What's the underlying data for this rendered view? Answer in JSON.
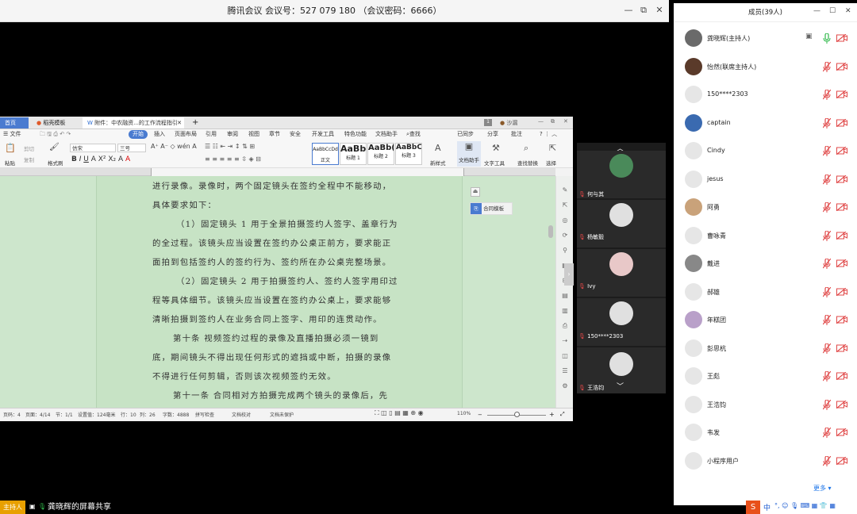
{
  "meeting": {
    "title": "腾讯会议 会议号：527 079 180 （会议密码：6666）",
    "ctrl_min": "—",
    "ctrl_restore": "⧉",
    "ctrl_close": "✕"
  },
  "wps": {
    "tabs": [
      "首页",
      "稻壳模板",
      "附件：中农融资...的工作流程指引"
    ],
    "tab_add": "+",
    "doc_user": "沙漏",
    "menus": [
      "☰ 文件",
      "开始",
      "插入",
      "页面布局",
      "引用",
      "审阅",
      "视图",
      "章节",
      "安全",
      "开发工具",
      "特色功能",
      "文档助手",
      "查找"
    ],
    "right_menus": [
      "已同步",
      "分享",
      "批注"
    ],
    "ribbon": {
      "paste": "粘贴",
      "cut": "剪切",
      "copy": "复制",
      "format_painter": "格式刷",
      "font": "仿宋",
      "size": "三号",
      "styles": [
        {
          "sample": "AaBbCcDd",
          "name": "正文"
        },
        {
          "sample": "AaBb",
          "name": "标题 1"
        },
        {
          "sample": "AaBb(",
          "name": "标题 2"
        },
        {
          "sample": "AaBbC(",
          "name": "标题 3"
        }
      ],
      "new_style": "新样式",
      "doc_helper": "文档助手",
      "text_tools": "文字工具",
      "find_replace": "查找替换",
      "select": "选择"
    },
    "doc_lines": [
      "进行录像。录像时，两个固定镜头在签约全程中不能移动，",
      "具体要求如下：",
      "（1）固定镜头 1 用于全景拍摄签约人签字、盖章行为",
      "的全过程。该镜头应当设置在签约办公桌正前方，要求能正",
      "面拍到包括签约人的签约行为、签约所在办公桌完整场景。",
      "（2）固定镜头 2 用于拍摄签约人、签约人签字用印过",
      "程等具体细节。该镜头应当设置在签约办公桌上，要求能够",
      "清晰拍摄到签约人在业务合同上签字、用印的连贯动作。",
      "第十条  视频签约过程的录像及直播拍摄必须一镜到",
      "底，期间镜头不得出现任何形式的遮挡或中断，拍摄的录像",
      "不得进行任何剪辑，否则该次视频签约无效。",
      "第十一条  合同相对方拍摄完成两个镜头的录像后，先"
    ],
    "float_panel": "合同模板",
    "status": {
      "page": "页码：4",
      "pages": "页面：4/14",
      "section": "节：1/1",
      "setting": "设置值：124毫米",
      "row": "行：10",
      "col": "列：26",
      "words": "字数：4888",
      "spell": "拼写检查",
      "proof": "文档校对",
      "protect": "文档未保护",
      "zoom": "110%"
    }
  },
  "video": {
    "up": "︿",
    "down": "﹀",
    "tiles": [
      {
        "name": "何与其"
      },
      {
        "name": "杨敏毅"
      },
      {
        "name": "Ivy"
      },
      {
        "name": "150****2303"
      },
      {
        "name": "王浩钧"
      }
    ]
  },
  "members": {
    "title": "成员(39人)",
    "ctrl_min": "—",
    "ctrl_max": "☐",
    "ctrl_close": "✕",
    "list": [
      {
        "name": "龚晓辉(主持人)",
        "avatar": "#6a6a6a",
        "mic": "on"
      },
      {
        "name": "怡然(联席主持人)",
        "avatar": "#5a3a2a",
        "mic": "off"
      },
      {
        "name": "150****2303",
        "avatar": "#e6e6e6",
        "mic": "off"
      },
      {
        "name": "captain",
        "avatar": "#3a6ab0",
        "mic": "off"
      },
      {
        "name": "Cindy",
        "avatar": "#e6e6e6",
        "mic": "off"
      },
      {
        "name": "jesus",
        "avatar": "#e6e6e6",
        "mic": "off"
      },
      {
        "name": "阿勇",
        "avatar": "#c9a27a",
        "mic": "off"
      },
      {
        "name": "曹咏青",
        "avatar": "#e6e6e6",
        "mic": "off"
      },
      {
        "name": "戴进",
        "avatar": "#888888",
        "mic": "off"
      },
      {
        "name": "郝雄",
        "avatar": "#e6e6e6",
        "mic": "off"
      },
      {
        "name": "年糕团",
        "avatar": "#b9a0c9",
        "mic": "off"
      },
      {
        "name": "彭思杭",
        "avatar": "#e6e6e6",
        "mic": "off"
      },
      {
        "name": "王彪",
        "avatar": "#e6e6e6",
        "mic": "off"
      },
      {
        "name": "王浩钧",
        "avatar": "#e6e6e6",
        "mic": "off"
      },
      {
        "name": "韦发",
        "avatar": "#e6e6e6",
        "mic": "off"
      },
      {
        "name": "小程序用户",
        "avatar": "#e6e6e6",
        "mic": "off"
      }
    ],
    "more": "更多 ▾"
  },
  "bottom": {
    "host_tag": "主持人",
    "share_text": "龚晓辉的屏幕共享",
    "tray_ime": "中"
  },
  "colors": {
    "accent": "#1a73e8",
    "muted_red": "#e04848",
    "mic_on": "#2fb84a",
    "doc_green": "#c7e3c5",
    "host_orange": "#e8a000"
  }
}
